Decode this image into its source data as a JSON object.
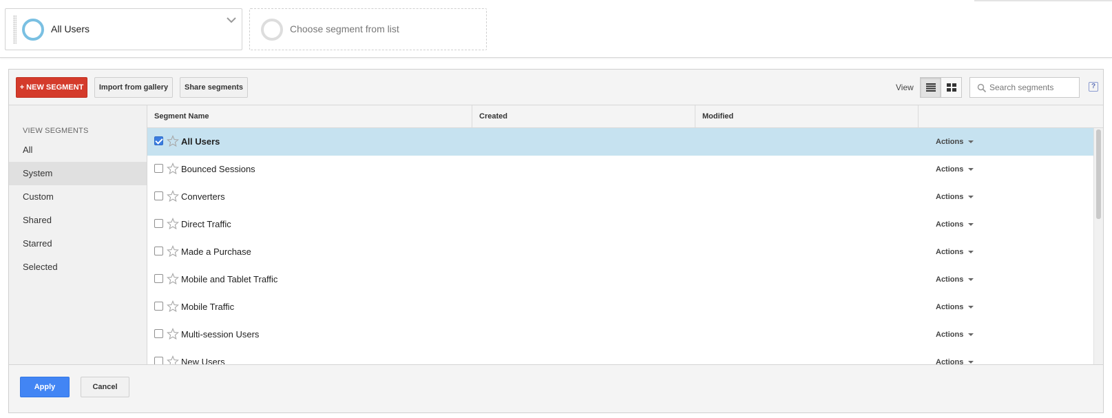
{
  "segment_bar": {
    "active_segment": "All Users",
    "empty_placeholder": "Choose segment from list"
  },
  "toolbar": {
    "new_segment_label": "+ NEW SEGMENT",
    "import_label": "Import from gallery",
    "share_label": "Share segments",
    "view_label": "View",
    "search_placeholder": "Search segments",
    "help_label": "?"
  },
  "sidebar": {
    "heading": "VIEW SEGMENTS",
    "items": [
      {
        "label": "All"
      },
      {
        "label": "System"
      },
      {
        "label": "Custom"
      },
      {
        "label": "Shared"
      },
      {
        "label": "Starred"
      },
      {
        "label": "Selected"
      }
    ],
    "selected": "System"
  },
  "table": {
    "columns": [
      "Segment Name",
      "Created",
      "Modified"
    ],
    "action_label": "Actions",
    "rows": [
      {
        "name": "All Users",
        "checked": true
      },
      {
        "name": "Bounced Sessions",
        "checked": false
      },
      {
        "name": "Converters",
        "checked": false
      },
      {
        "name": "Direct Traffic",
        "checked": false
      },
      {
        "name": "Made a Purchase",
        "checked": false
      },
      {
        "name": "Mobile and Tablet Traffic",
        "checked": false
      },
      {
        "name": "Mobile Traffic",
        "checked": false
      },
      {
        "name": "Multi-session Users",
        "checked": false
      },
      {
        "name": "New Users",
        "checked": false
      }
    ]
  },
  "footer": {
    "apply_label": "Apply",
    "cancel_label": "Cancel"
  },
  "colors": {
    "accent_red": "#d43b2b",
    "accent_blue": "#4285f4",
    "selected_row": "#c6e2f0",
    "segment_ring": "#7ac0e2"
  }
}
